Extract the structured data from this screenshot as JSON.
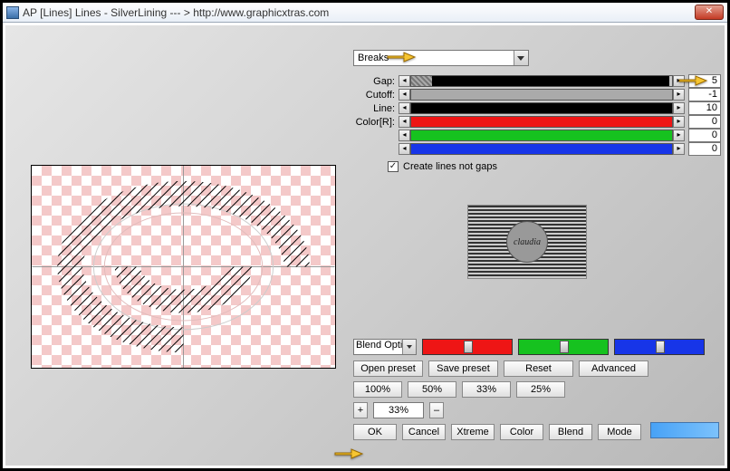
{
  "title": "AP [Lines]  Lines - SilverLining   --- >  http://www.graphicxtras.com",
  "dropdown_label": "Breaks",
  "sliders": [
    {
      "label": "Gap:",
      "value": "5",
      "fill_color": "#000",
      "fill_pct": 99,
      "prefix_hatch": 8
    },
    {
      "label": "Cutoff:",
      "value": "-1",
      "fill_color": "#aaa",
      "fill_pct": 100
    },
    {
      "label": "Line:",
      "value": "10",
      "fill_color": "#000",
      "fill_pct": 100
    },
    {
      "label": "Color[R]:",
      "value": "0",
      "fill_color": "#ee1515",
      "fill_pct": 100
    },
    {
      "label": "",
      "value": "0",
      "fill_color": "#16c21f",
      "fill_pct": 100
    },
    {
      "label": "",
      "value": "0",
      "fill_color": "#1735e8",
      "fill_pct": 100
    }
  ],
  "checkbox_label": "Create lines not gaps",
  "checkbox_checked": true,
  "blend_select": "Blend Opti",
  "rgb_sliders": [
    {
      "bg": "#ee1515"
    },
    {
      "bg": "#16c21f"
    },
    {
      "bg": "#1735e8"
    }
  ],
  "preset_buttons": {
    "open": "Open preset",
    "save": "Save preset",
    "reset": "Reset",
    "advanced": "Advanced"
  },
  "zoom_buttons": [
    "100%",
    "50%",
    "33%",
    "25%"
  ],
  "zoom_input": "33%",
  "zoom_plus": "+",
  "zoom_minus": "–",
  "bottom_buttons": [
    "OK",
    "Cancel",
    "Xtreme",
    "Color",
    "Blend",
    "Mode"
  ],
  "logo_text": "claudia"
}
